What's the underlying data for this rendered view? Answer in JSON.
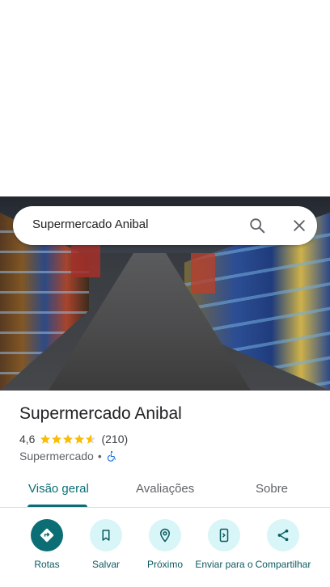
{
  "search": {
    "query": "Supermercado Anibal"
  },
  "place": {
    "name": "Supermercado Anibal",
    "rating": "4,6",
    "rating_value": 4.6,
    "review_count": "(210)",
    "category": "Supermercado",
    "separator": "•"
  },
  "tabs": [
    {
      "label": "Visão geral",
      "active": true
    },
    {
      "label": "Avaliações",
      "active": false
    },
    {
      "label": "Sobre",
      "active": false
    }
  ],
  "actions": [
    {
      "label": "Rotas",
      "icon": "directions-icon"
    },
    {
      "label": "Salvar",
      "icon": "bookmark-icon"
    },
    {
      "label": "Próximo",
      "icon": "nearby-icon"
    },
    {
      "label": "Enviar para o",
      "icon": "send-to-phone-icon"
    },
    {
      "label": "Compartilhar",
      "icon": "share-icon"
    }
  ],
  "colors": {
    "accent": "#0b6e74",
    "star": "#fbbc04",
    "action_bg": "#d8f5f7",
    "accessibility": "#1a73e8"
  }
}
